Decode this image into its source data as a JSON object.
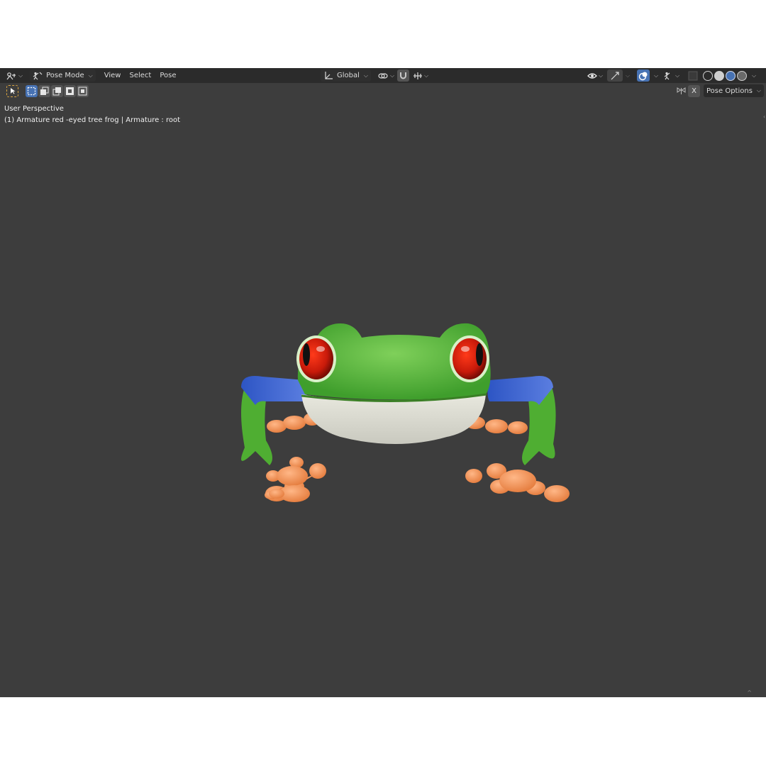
{
  "header": {
    "mode_label": "Pose Mode",
    "menus": [
      "View",
      "Select",
      "Pose"
    ],
    "orientation_label": "Global"
  },
  "toolbar": {
    "pose_options_label": "Pose Options",
    "x_label": "X"
  },
  "viewport": {
    "perspective_label": "User Perspective",
    "object_info": "(1) Armature red -eyed tree frog | Armature : root"
  },
  "colors": {
    "viewport_bg": "#3d3d3d",
    "header_bg": "#2b2b2b",
    "accent": "#4772b3"
  }
}
